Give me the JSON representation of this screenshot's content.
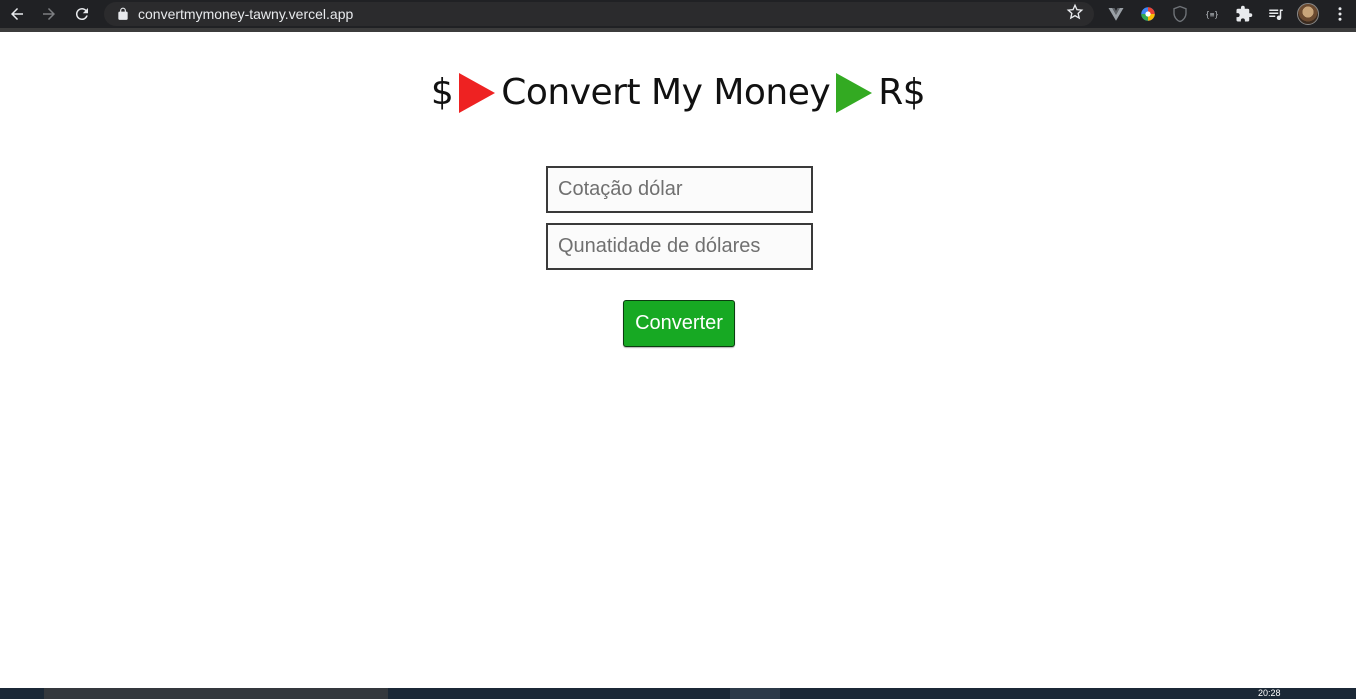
{
  "browser": {
    "url": "convertmymoney-tawny.vercel.app"
  },
  "header": {
    "prefix": "$",
    "title": "Convert My Money",
    "suffix": "R$",
    "left_arrow_color": "#ee2222",
    "right_arrow_color": "#33aa22"
  },
  "form": {
    "rate_placeholder": "Cotação dólar",
    "amount_placeholder": "Qunatidade de dólares",
    "convert_label": "Converter",
    "button_color": "#17a923"
  },
  "taskbar": {
    "clock": "20:28"
  }
}
